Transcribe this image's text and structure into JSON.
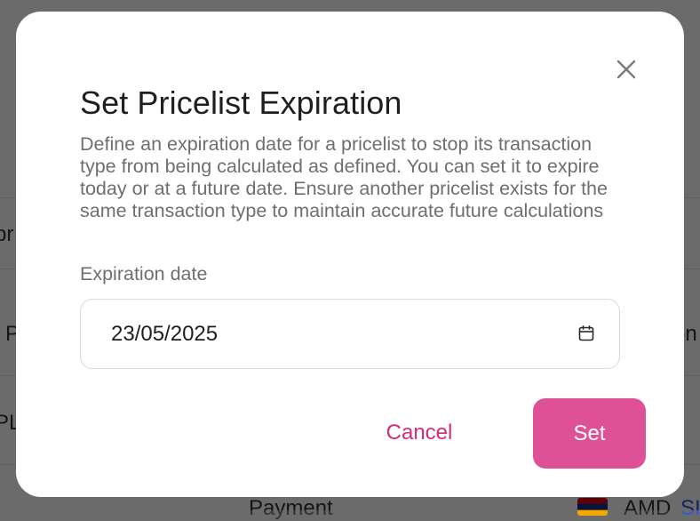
{
  "background": {
    "fragments": [
      "pr",
      "P",
      "on",
      "PL",
      "Payment",
      "AMD",
      "SI"
    ]
  },
  "dialog": {
    "title": "Set Pricelist Expiration",
    "description": "Define an expiration date for a pricelist to stop its transaction type from being calculated as defined. You can set it to expire today or at a future date. Ensure another pricelist exists for the same transaction type to maintain accurate future calculations",
    "field_label": "Expiration date",
    "date_value": "23/05/2025",
    "cancel_label": "Cancel",
    "set_label": "Set",
    "close_icon": "close-icon",
    "calendar_icon": "calendar-icon"
  },
  "colors": {
    "accent": "#df5197",
    "cancel_text": "#d22d78",
    "overlay": "rgba(0,0,0,0.58)"
  }
}
